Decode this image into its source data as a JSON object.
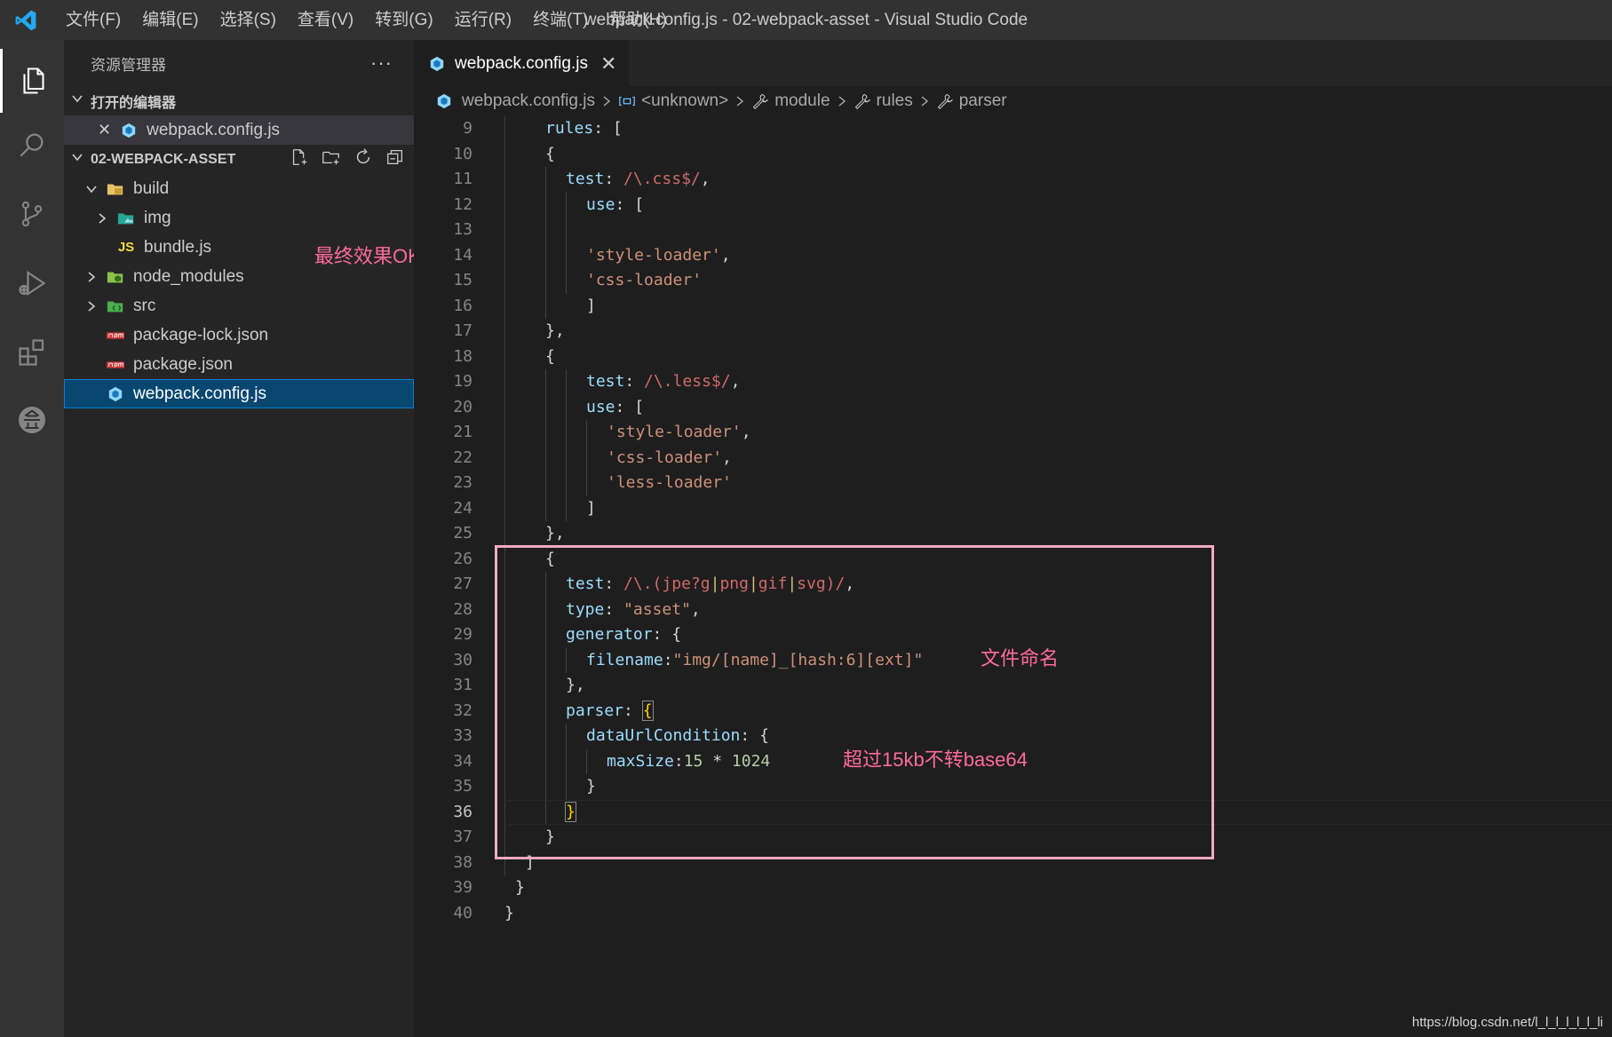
{
  "titlebar": {
    "menu": [
      "文件(F)",
      "编辑(E)",
      "选择(S)",
      "查看(V)",
      "转到(G)",
      "运行(R)",
      "终端(T)",
      "帮助(H)"
    ],
    "window_title": "webpack.config.js - 02-webpack-asset - Visual Studio Code"
  },
  "sidebar": {
    "title": "资源管理器",
    "more": "···",
    "open_editors": {
      "heading": "打开的编辑器",
      "items": [
        {
          "close": "✕",
          "name": "webpack.config.js"
        }
      ]
    },
    "project": {
      "heading": "02-WEBPACK-ASSET",
      "tree": [
        {
          "name": "build",
          "type": "folder",
          "expanded": true
        },
        {
          "name": "img",
          "type": "folder",
          "expanded": false
        },
        {
          "name": "bundle.js",
          "type": "js"
        },
        {
          "name": "node_modules",
          "type": "folder",
          "expanded": false
        },
        {
          "name": "src",
          "type": "folder",
          "expanded": false
        },
        {
          "name": "package-lock.json",
          "type": "json"
        },
        {
          "name": "package.json",
          "type": "json"
        },
        {
          "name": "webpack.config.js",
          "type": "webpack",
          "selected": true
        }
      ]
    },
    "annotation": "最终效果OK"
  },
  "editor": {
    "tab": {
      "label": "webpack.config.js",
      "close": "✕"
    },
    "breadcrumb": [
      "webpack.config.js",
      "<unknown>",
      "module",
      "rules",
      "parser"
    ],
    "current_line": 36,
    "annotations": {
      "filename": "文件命名",
      "maxsize": "超过15kb不转base64"
    },
    "watermark": "https://blog.csdn.net/l_l_l_l_l_l_li"
  },
  "code": {
    "lines": [
      {
        "n": "9"
      },
      {
        "n": "10"
      },
      {
        "n": "11"
      },
      {
        "n": "12"
      },
      {
        "n": "13"
      },
      {
        "n": "14"
      },
      {
        "n": "15"
      },
      {
        "n": "16"
      },
      {
        "n": "17"
      },
      {
        "n": "18"
      },
      {
        "n": "19"
      },
      {
        "n": "20"
      },
      {
        "n": "21"
      },
      {
        "n": "22"
      },
      {
        "n": "23"
      },
      {
        "n": "24"
      },
      {
        "n": "25"
      },
      {
        "n": "26"
      },
      {
        "n": "27"
      },
      {
        "n": "28"
      },
      {
        "n": "29"
      },
      {
        "n": "30"
      },
      {
        "n": "31"
      },
      {
        "n": "32"
      },
      {
        "n": "33"
      },
      {
        "n": "34"
      },
      {
        "n": "35"
      },
      {
        "n": "36"
      },
      {
        "n": "37"
      },
      {
        "n": "38"
      },
      {
        "n": "39"
      },
      {
        "n": "40"
      }
    ],
    "tokens": {
      "rules": "rules",
      "test": "test",
      "use": "use",
      "type": "type",
      "generator": "generator",
      "filename": "filename",
      "parser": "parser",
      "dataUrlCondition": "dataUrlCondition",
      "maxSize": "maxSize",
      "re_css": "/\\.css$/",
      "re_less": "/\\.less$/",
      "style_loader": "'style-loader'",
      "css_loader": "'css-loader'",
      "less_loader": "'less-loader'",
      "asset": "\"asset\"",
      "filename_value": "\"img/[name]_[hash:6][ext]\"",
      "n15": "15",
      "n1024": "1024"
    }
  }
}
